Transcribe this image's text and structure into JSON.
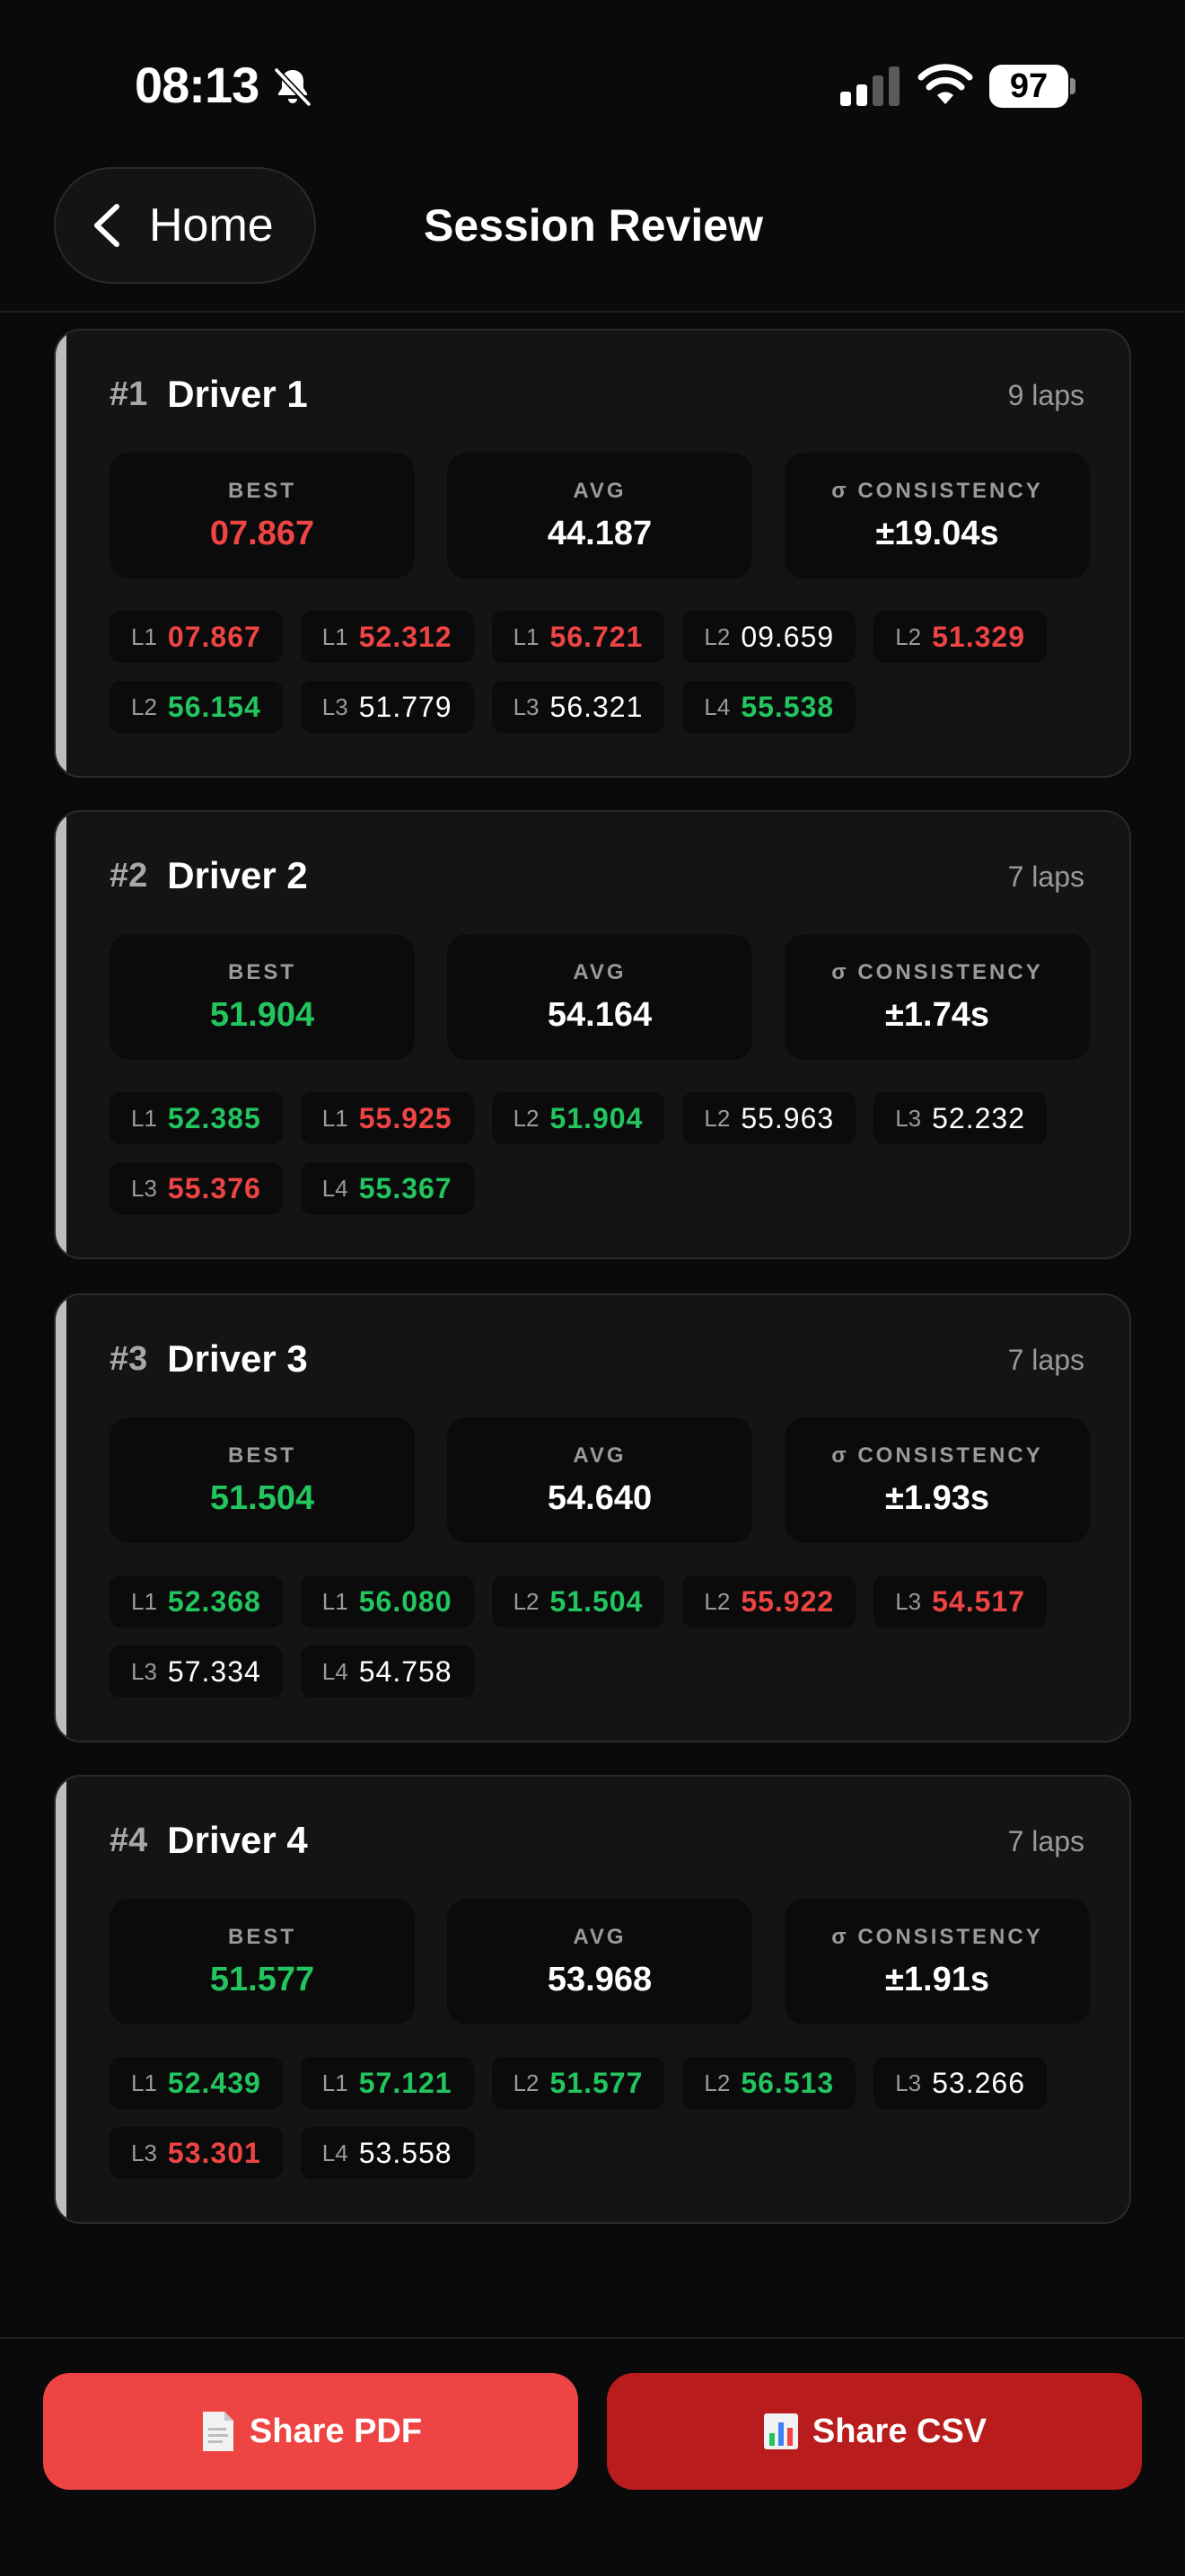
{
  "status_bar": {
    "time": "08:13",
    "battery": "97"
  },
  "header": {
    "back_label": "Home",
    "title": "Session Review"
  },
  "drivers": [
    {
      "rank": "#1",
      "name": "Driver 1",
      "laps_count": "9 laps",
      "best_label": "BEST",
      "best": "07.867",
      "best_color": "#ef4444",
      "avg_label": "AVG",
      "avg": "44.187",
      "consistency_label": "σ CONSISTENCY",
      "consistency": "±19.04s",
      "laps": [
        {
          "label": "L1",
          "time": "07.867",
          "color": "red"
        },
        {
          "label": "L1",
          "time": "52.312",
          "color": "red"
        },
        {
          "label": "L1",
          "time": "56.721",
          "color": "red"
        },
        {
          "label": "L2",
          "time": "09.659",
          "color": "white"
        },
        {
          "label": "L2",
          "time": "51.329",
          "color": "red"
        },
        {
          "label": "L2",
          "time": "56.154",
          "color": "green"
        },
        {
          "label": "L3",
          "time": "51.779",
          "color": "white"
        },
        {
          "label": "L3",
          "time": "56.321",
          "color": "white"
        },
        {
          "label": "L4",
          "time": "55.538",
          "color": "green"
        }
      ]
    },
    {
      "rank": "#2",
      "name": "Driver 2",
      "laps_count": "7 laps",
      "best_label": "BEST",
      "best": "51.904",
      "best_color": "#22c55e",
      "avg_label": "AVG",
      "avg": "54.164",
      "consistency_label": "σ CONSISTENCY",
      "consistency": "±1.74s",
      "laps": [
        {
          "label": "L1",
          "time": "52.385",
          "color": "green"
        },
        {
          "label": "L1",
          "time": "55.925",
          "color": "red"
        },
        {
          "label": "L2",
          "time": "51.904",
          "color": "green"
        },
        {
          "label": "L2",
          "time": "55.963",
          "color": "white"
        },
        {
          "label": "L3",
          "time": "52.232",
          "color": "white"
        },
        {
          "label": "L3",
          "time": "55.376",
          "color": "red"
        },
        {
          "label": "L4",
          "time": "55.367",
          "color": "green"
        }
      ]
    },
    {
      "rank": "#3",
      "name": "Driver 3",
      "laps_count": "7 laps",
      "best_label": "BEST",
      "best": "51.504",
      "best_color": "#22c55e",
      "avg_label": "AVG",
      "avg": "54.640",
      "consistency_label": "σ CONSISTENCY",
      "consistency": "±1.93s",
      "laps": [
        {
          "label": "L1",
          "time": "52.368",
          "color": "green"
        },
        {
          "label": "L1",
          "time": "56.080",
          "color": "green"
        },
        {
          "label": "L2",
          "time": "51.504",
          "color": "green"
        },
        {
          "label": "L2",
          "time": "55.922",
          "color": "red"
        },
        {
          "label": "L3",
          "time": "54.517",
          "color": "red"
        },
        {
          "label": "L3",
          "time": "57.334",
          "color": "white"
        },
        {
          "label": "L4",
          "time": "54.758",
          "color": "white"
        }
      ]
    },
    {
      "rank": "#4",
      "name": "Driver 4",
      "laps_count": "7 laps",
      "best_label": "BEST",
      "best": "51.577",
      "best_color": "#22c55e",
      "avg_label": "AVG",
      "avg": "53.968",
      "consistency_label": "σ CONSISTENCY",
      "consistency": "±1.91s",
      "laps": [
        {
          "label": "L1",
          "time": "52.439",
          "color": "green"
        },
        {
          "label": "L1",
          "time": "57.121",
          "color": "green"
        },
        {
          "label": "L2",
          "time": "51.577",
          "color": "green"
        },
        {
          "label": "L2",
          "time": "56.513",
          "color": "green"
        },
        {
          "label": "L3",
          "time": "53.266",
          "color": "white"
        },
        {
          "label": "L3",
          "time": "53.301",
          "color": "red"
        },
        {
          "label": "L4",
          "time": "53.558",
          "color": "white"
        }
      ]
    }
  ],
  "footer": {
    "pdf_label": "Share PDF",
    "pdf_icon": "document-icon",
    "pdf_color": "#ef4444",
    "csv_label": "Share CSV",
    "csv_icon": "bar-chart-icon",
    "csv_color": "#b91c1c"
  }
}
